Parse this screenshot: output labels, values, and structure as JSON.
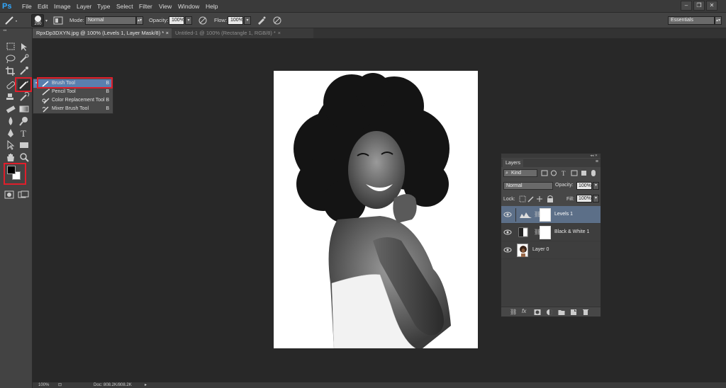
{
  "app": {
    "logo": "Ps"
  },
  "menu": [
    "File",
    "Edit",
    "Image",
    "Layer",
    "Type",
    "Select",
    "Filter",
    "View",
    "Window",
    "Help"
  ],
  "window_controls": [
    "–",
    "❐",
    "✕"
  ],
  "options": {
    "brush_size": "200",
    "mode_label": "Mode:",
    "mode_value": "Normal",
    "opacity_label": "Opacity:",
    "opacity_value": "100%",
    "flow_label": "Flow:",
    "flow_value": "100%",
    "workspace": "Essentials"
  },
  "tabs": [
    {
      "label": "RpxDp3DXYN.jpg @ 100% (Levels 1, Layer Mask/8) *",
      "close": "×",
      "active": true
    },
    {
      "label": "Untitled-1 @ 100% (Rectangle 1, RGB/8) *",
      "close": "×",
      "active": false
    }
  ],
  "flyout": {
    "items": [
      {
        "label": "Brush Tool",
        "key": "B",
        "selected": true,
        "icon": "brush-icon"
      },
      {
        "label": "Pencil Tool",
        "key": "B",
        "selected": false,
        "icon": "pencil-icon"
      },
      {
        "label": "Color Replacement Tool",
        "key": "B",
        "selected": false,
        "icon": "color-replacement-icon"
      },
      {
        "label": "Mixer Brush Tool",
        "key": "B",
        "selected": false,
        "icon": "mixer-brush-icon"
      }
    ]
  },
  "layers_panel": {
    "title": "Layers",
    "kind_label": "Kind",
    "blend_mode": "Normal",
    "opacity_label": "Opacity:",
    "opacity_value": "100%",
    "lock_label": "Lock:",
    "fill_label": "Fill:",
    "fill_value": "100%",
    "layers": [
      {
        "name": "Levels 1",
        "selected": true
      },
      {
        "name": "Black & White 1",
        "selected": false
      },
      {
        "name": "Layer 0",
        "selected": false
      }
    ],
    "footer_icons": [
      "link-icon",
      "fx-icon",
      "mask-icon",
      "adjustment-icon",
      "folder-icon",
      "new-layer-icon",
      "trash-icon"
    ],
    "fx_label": "fx"
  },
  "status": {
    "zoom": "100%",
    "doc": "Doc: 808.2K/808.2K"
  },
  "colors": {
    "accent_blue": "#31a8ff",
    "highlight_red": "#e01e2b",
    "selected_layer": "#5c6f88",
    "flyout_selected": "#5a7fae"
  }
}
